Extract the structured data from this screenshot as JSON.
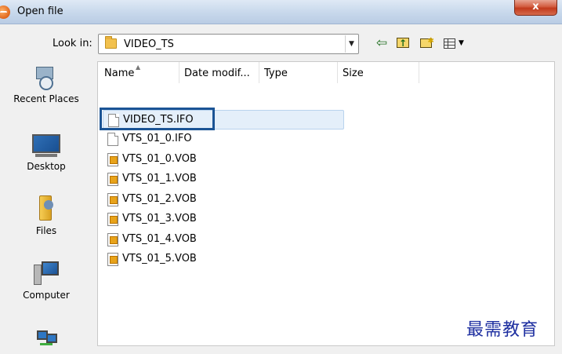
{
  "window": {
    "title": "Open file",
    "close_label": "x"
  },
  "toolbar": {
    "lookin_label": "Look in:",
    "lookin_value": "VIDEO_TS",
    "dropdown_arrow": "▼",
    "back_icon": "arrow-left-icon",
    "back_glyph": "⇦",
    "views_dropdown": "▼"
  },
  "places": [
    {
      "label": "Recent Places",
      "icon": "recent-places-icon"
    },
    {
      "label": "Desktop",
      "icon": "desktop-icon"
    },
    {
      "label": "Files",
      "icon": "user-files-icon"
    },
    {
      "label": "Computer",
      "icon": "computer-icon"
    },
    {
      "label": "",
      "icon": "network-icon"
    }
  ],
  "columns": [
    "Name",
    "Date modif...",
    "Type",
    "Size"
  ],
  "files": [
    {
      "name": "VIDEO_TS.IFO",
      "kind": "doc",
      "selected": true
    },
    {
      "name": "VTS_01_0.IFO",
      "kind": "doc"
    },
    {
      "name": "VTS_01_0.VOB",
      "kind": "vob"
    },
    {
      "name": "VTS_01_1.VOB",
      "kind": "vob"
    },
    {
      "name": "VTS_01_2.VOB",
      "kind": "vob"
    },
    {
      "name": "VTS_01_3.VOB",
      "kind": "vob"
    },
    {
      "name": "VTS_01_4.VOB",
      "kind": "vob"
    },
    {
      "name": "VTS_01_5.VOB",
      "kind": "vob"
    }
  ],
  "watermark": "最需教育",
  "colors": {
    "selection_border": "#1b5495",
    "selection_fill": "#e4effa",
    "watermark": "#1e2fa0"
  }
}
